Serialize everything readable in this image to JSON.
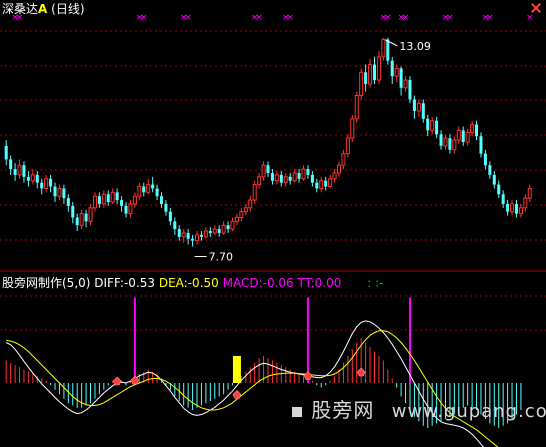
{
  "header": {
    "stock_name": "深桑达",
    "stock_suffix": "A",
    "period": "(日线)"
  },
  "price_annotations": {
    "high_label": "13.09",
    "low_label": "7.70"
  },
  "indicator": {
    "name": "股旁网制作(5,0)",
    "diff": "DIFF:-0.53",
    "dea": "DEA:-0.50",
    "macd": "MACD:-0.06",
    "tt": "TT:0.00",
    "dots": ": :-"
  },
  "watermark": {
    "site_cn": "股旁网",
    "site_url": "www.gupang.com"
  },
  "colors": {
    "background": "#000000",
    "up_candle": "#ff3232",
    "down_candle": "#54ffff",
    "grid": "#aa0000",
    "diff_line": "#ffffff",
    "dea_line": "#ffff00",
    "macd_pos": "#ff3232",
    "macd_neg": "#54ffff",
    "tt_bar": "#ff00ff",
    "signal_bar": "#ffff00"
  },
  "chart_data": {
    "type": "candlestick",
    "price_range": [
      7.3,
      13.5
    ],
    "candles": [
      [
        10.3,
        9.95,
        10.45,
        9.8
      ],
      [
        9.95,
        9.7,
        10.05,
        9.55
      ],
      [
        9.7,
        9.55,
        9.85,
        9.4
      ],
      [
        9.55,
        9.8,
        9.95,
        9.45
      ],
      [
        9.8,
        9.5,
        9.9,
        9.35
      ],
      [
        9.5,
        9.4,
        9.65,
        9.25
      ],
      [
        9.4,
        9.55,
        9.7,
        9.3
      ],
      [
        9.55,
        9.35,
        9.65,
        9.2
      ],
      [
        9.35,
        9.2,
        9.45,
        9.05
      ],
      [
        9.2,
        9.45,
        9.55,
        9.1
      ],
      [
        9.45,
        9.25,
        9.55,
        9.1
      ],
      [
        9.25,
        9.0,
        9.35,
        8.85
      ],
      [
        9.0,
        9.2,
        9.3,
        8.9
      ],
      [
        9.2,
        8.95,
        9.3,
        8.8
      ],
      [
        8.95,
        8.75,
        9.05,
        8.6
      ],
      [
        8.75,
        8.45,
        8.85,
        8.3
      ],
      [
        8.45,
        8.25,
        8.55,
        8.1
      ],
      [
        8.25,
        8.55,
        8.65,
        8.15
      ],
      [
        8.55,
        8.35,
        8.65,
        8.2
      ],
      [
        8.35,
        8.7,
        8.8,
        8.25
      ],
      [
        8.7,
        9.0,
        9.1,
        8.6
      ],
      [
        9.0,
        8.8,
        9.1,
        8.7
      ],
      [
        8.8,
        9.05,
        9.15,
        8.7
      ],
      [
        9.05,
        8.85,
        9.15,
        8.75
      ],
      [
        8.85,
        9.1,
        9.2,
        8.8
      ],
      [
        9.1,
        8.9,
        9.2,
        8.8
      ],
      [
        8.9,
        8.75,
        9.0,
        8.6
      ],
      [
        8.75,
        8.55,
        8.85,
        8.45
      ],
      [
        8.55,
        8.8,
        8.9,
        8.45
      ],
      [
        8.8,
        9.0,
        9.1,
        8.7
      ],
      [
        9.0,
        9.25,
        9.35,
        8.9
      ],
      [
        9.25,
        9.1,
        9.35,
        9.0
      ],
      [
        9.1,
        9.3,
        9.45,
        9.05
      ],
      [
        9.3,
        9.2,
        9.5,
        9.1
      ],
      [
        9.2,
        9.0,
        9.3,
        8.9
      ],
      [
        9.0,
        8.8,
        9.1,
        8.7
      ],
      [
        8.8,
        8.6,
        8.9,
        8.5
      ],
      [
        8.6,
        8.35,
        8.7,
        8.25
      ],
      [
        8.35,
        8.15,
        8.45,
        8.0
      ],
      [
        8.15,
        7.95,
        8.25,
        7.85
      ],
      [
        7.95,
        8.05,
        8.15,
        7.8
      ],
      [
        8.05,
        7.9,
        8.15,
        7.75
      ],
      [
        7.9,
        7.85,
        8.0,
        7.7
      ],
      [
        7.85,
        8.0,
        8.1,
        7.75
      ],
      [
        8.0,
        7.95,
        8.1,
        7.85
      ],
      [
        7.95,
        8.1,
        8.2,
        7.9
      ],
      [
        8.1,
        8.05,
        8.2,
        7.95
      ],
      [
        8.05,
        8.15,
        8.25,
        8.0
      ],
      [
        8.15,
        8.05,
        8.25,
        7.95
      ],
      [
        8.05,
        8.25,
        8.35,
        8.0
      ],
      [
        8.25,
        8.15,
        8.35,
        8.05
      ],
      [
        8.15,
        8.35,
        8.45,
        8.1
      ],
      [
        8.35,
        8.45,
        8.55,
        8.25
      ],
      [
        8.45,
        8.6,
        8.7,
        8.35
      ],
      [
        8.6,
        8.7,
        8.8,
        8.5
      ],
      [
        8.7,
        8.9,
        9.0,
        8.6
      ],
      [
        8.9,
        9.3,
        9.4,
        8.8
      ],
      [
        9.3,
        9.5,
        9.6,
        9.2
      ],
      [
        9.5,
        9.8,
        9.9,
        9.4
      ],
      [
        9.8,
        9.6,
        9.9,
        9.5
      ],
      [
        9.6,
        9.4,
        9.7,
        9.3
      ],
      [
        9.4,
        9.55,
        9.65,
        9.3
      ],
      [
        9.55,
        9.35,
        9.65,
        9.25
      ],
      [
        9.35,
        9.5,
        9.6,
        9.25
      ],
      [
        9.5,
        9.4,
        9.6,
        9.3
      ],
      [
        9.4,
        9.6,
        9.7,
        9.35
      ],
      [
        9.6,
        9.45,
        9.7,
        9.35
      ],
      [
        9.45,
        9.7,
        9.8,
        9.4
      ],
      [
        9.7,
        9.55,
        9.8,
        9.45
      ],
      [
        9.55,
        9.35,
        9.65,
        9.25
      ],
      [
        9.35,
        9.2,
        9.45,
        9.1
      ],
      [
        9.2,
        9.4,
        9.5,
        9.1
      ],
      [
        9.4,
        9.25,
        9.5,
        9.15
      ],
      [
        9.25,
        9.45,
        9.55,
        9.2
      ],
      [
        9.45,
        9.6,
        9.7,
        9.35
      ],
      [
        9.6,
        9.8,
        9.9,
        9.5
      ],
      [
        9.8,
        10.1,
        10.2,
        9.7
      ],
      [
        10.1,
        10.5,
        10.6,
        10.0
      ],
      [
        10.5,
        11.0,
        11.1,
        10.4
      ],
      [
        11.0,
        11.6,
        11.7,
        10.9
      ],
      [
        11.6,
        12.2,
        12.3,
        11.5
      ],
      [
        12.2,
        11.9,
        12.4,
        11.7
      ],
      [
        11.9,
        12.4,
        12.55,
        11.8
      ],
      [
        12.4,
        12.0,
        12.6,
        11.9
      ],
      [
        12.0,
        12.6,
        12.75,
        11.9
      ],
      [
        12.6,
        13.05,
        13.09,
        12.5
      ],
      [
        13.05,
        12.5,
        13.09,
        12.4
      ],
      [
        12.5,
        12.1,
        12.6,
        11.9
      ],
      [
        12.1,
        12.3,
        12.4,
        11.95
      ],
      [
        12.3,
        11.8,
        12.35,
        11.6
      ],
      [
        11.8,
        12.0,
        12.1,
        11.7
      ],
      [
        12.0,
        11.5,
        12.1,
        11.4
      ],
      [
        11.5,
        11.2,
        11.6,
        11.0
      ],
      [
        11.2,
        11.4,
        11.5,
        11.05
      ],
      [
        11.4,
        11.0,
        11.5,
        10.9
      ],
      [
        11.0,
        10.7,
        11.1,
        10.55
      ],
      [
        10.7,
        10.95,
        11.05,
        10.6
      ],
      [
        10.95,
        10.6,
        11.05,
        10.5
      ],
      [
        10.6,
        10.3,
        10.7,
        10.2
      ],
      [
        10.3,
        10.5,
        10.6,
        10.2
      ],
      [
        10.5,
        10.2,
        10.6,
        10.1
      ],
      [
        10.2,
        10.45,
        10.55,
        10.1
      ],
      [
        10.45,
        10.7,
        10.8,
        10.35
      ],
      [
        10.7,
        10.4,
        10.8,
        10.3
      ],
      [
        10.4,
        10.65,
        10.75,
        10.3
      ],
      [
        10.65,
        10.85,
        10.95,
        10.55
      ],
      [
        10.85,
        10.55,
        10.95,
        10.45
      ],
      [
        10.55,
        10.1,
        10.65,
        10.0
      ],
      [
        10.1,
        9.8,
        10.2,
        9.7
      ],
      [
        9.8,
        9.55,
        9.9,
        9.45
      ],
      [
        9.55,
        9.3,
        9.65,
        9.2
      ],
      [
        9.3,
        9.05,
        9.4,
        8.95
      ],
      [
        9.05,
        8.8,
        9.15,
        8.7
      ],
      [
        8.8,
        8.6,
        8.9,
        8.5
      ],
      [
        8.6,
        8.8,
        8.9,
        8.5
      ],
      [
        8.8,
        8.55,
        8.9,
        8.45
      ],
      [
        8.55,
        8.7,
        8.8,
        8.45
      ],
      [
        8.7,
        8.95,
        9.05,
        8.6
      ],
      [
        8.95,
        9.2,
        9.3,
        8.85
      ]
    ],
    "macd_hist": [
      0.5,
      0.45,
      0.4,
      0.35,
      0.3,
      0.25,
      0.2,
      0.15,
      0.1,
      0.05,
      -0.05,
      -0.15,
      -0.25,
      -0.35,
      -0.45,
      -0.5,
      -0.55,
      -0.55,
      -0.5,
      -0.45,
      -0.35,
      -0.25,
      -0.15,
      -0.05,
      0.05,
      0.1,
      0.05,
      -0.05,
      0.05,
      0.15,
      0.2,
      0.25,
      0.3,
      0.25,
      0.2,
      0.1,
      -0.05,
      -0.15,
      -0.3,
      -0.4,
      -0.5,
      -0.55,
      -0.6,
      -0.55,
      -0.5,
      -0.45,
      -0.4,
      -0.35,
      -0.3,
      -0.25,
      -0.15,
      -0.05,
      0.05,
      0.15,
      0.25,
      0.35,
      0.45,
      0.55,
      0.6,
      0.55,
      0.5,
      0.45,
      0.4,
      0.35,
      0.3,
      0.25,
      0.2,
      0.15,
      0.1,
      0.05,
      -0.05,
      -0.1,
      -0.05,
      0.05,
      0.15,
      0.3,
      0.45,
      0.6,
      0.75,
      0.9,
      1.0,
      0.9,
      0.8,
      0.7,
      0.6,
      0.5,
      0.3,
      0.1,
      -0.1,
      -0.3,
      -0.45,
      -0.6,
      -0.75,
      -0.85,
      -0.95,
      -1.0,
      -0.95,
      -0.9,
      -0.85,
      -0.8,
      -0.75,
      -0.7,
      -0.6,
      -0.55,
      -0.5,
      -0.55,
      -0.6,
      -0.7,
      -0.8,
      -0.9,
      -0.95,
      -1.0,
      -0.95,
      -0.9,
      -0.8,
      -0.7,
      -0.6
    ],
    "diff_line": [
      0.9,
      0.85,
      0.75,
      0.62,
      0.48,
      0.35,
      0.22,
      0.1,
      -0.02,
      -0.12,
      -0.22,
      -0.32,
      -0.42,
      -0.5,
      -0.58,
      -0.64,
      -0.68,
      -0.66,
      -0.6,
      -0.52,
      -0.42,
      -0.32,
      -0.22,
      -0.14,
      -0.06,
      0.0,
      0.02,
      0.0,
      0.04,
      0.1,
      0.16,
      0.2,
      0.24,
      0.22,
      0.16,
      0.06,
      -0.06,
      -0.18,
      -0.32,
      -0.44,
      -0.56,
      -0.64,
      -0.7,
      -0.72,
      -0.7,
      -0.66,
      -0.6,
      -0.54,
      -0.46,
      -0.38,
      -0.28,
      -0.18,
      -0.06,
      0.06,
      0.16,
      0.26,
      0.34,
      0.4,
      0.44,
      0.42,
      0.38,
      0.34,
      0.3,
      0.27,
      0.24,
      0.22,
      0.2,
      0.18,
      0.16,
      0.14,
      0.12,
      0.12,
      0.16,
      0.24,
      0.36,
      0.52,
      0.7,
      0.9,
      1.1,
      1.25,
      1.35,
      1.38,
      1.36,
      1.3,
      1.22,
      1.12,
      1.0,
      0.86,
      0.7,
      0.54,
      0.36,
      0.18,
      0.0,
      -0.18,
      -0.36,
      -0.52,
      -0.66,
      -0.78,
      -0.86,
      -0.9,
      -0.92,
      -0.94,
      -0.96,
      -1.0,
      -1.06,
      -1.14,
      -1.24,
      -1.36,
      -1.48,
      -1.58,
      -1.66,
      -1.72,
      -1.76,
      -1.76,
      -1.72,
      -1.66,
      -1.58
    ],
    "dea_line": [
      0.95,
      0.93,
      0.9,
      0.85,
      0.78,
      0.7,
      0.6,
      0.5,
      0.4,
      0.3,
      0.2,
      0.1,
      0.0,
      -0.1,
      -0.2,
      -0.3,
      -0.38,
      -0.44,
      -0.48,
      -0.5,
      -0.5,
      -0.48,
      -0.44,
      -0.38,
      -0.32,
      -0.26,
      -0.2,
      -0.14,
      -0.08,
      -0.04,
      0.0,
      0.04,
      0.08,
      0.1,
      0.1,
      0.08,
      0.04,
      -0.02,
      -0.1,
      -0.18,
      -0.28,
      -0.36,
      -0.44,
      -0.5,
      -0.55,
      -0.58,
      -0.6,
      -0.6,
      -0.58,
      -0.55,
      -0.5,
      -0.44,
      -0.36,
      -0.28,
      -0.2,
      -0.12,
      -0.04,
      0.04,
      0.1,
      0.15,
      0.18,
      0.2,
      0.21,
      0.22,
      0.22,
      0.22,
      0.21,
      0.2,
      0.19,
      0.18,
      0.17,
      0.16,
      0.16,
      0.17,
      0.2,
      0.26,
      0.34,
      0.44,
      0.56,
      0.7,
      0.84,
      0.96,
      1.06,
      1.12,
      1.16,
      1.16,
      1.14,
      1.08,
      1.0,
      0.9,
      0.78,
      0.64,
      0.5,
      0.34,
      0.18,
      0.02,
      -0.14,
      -0.3,
      -0.44,
      -0.56,
      -0.66,
      -0.74,
      -0.8,
      -0.86,
      -0.92,
      -0.98,
      -1.04,
      -1.12,
      -1.2,
      -1.28,
      -1.36,
      -1.44,
      -1.5,
      -1.56,
      -1.6,
      -1.62,
      -1.62
    ],
    "tt_spikes": [
      [
        29,
        1.9
      ],
      [
        68,
        1.9
      ],
      [
        91,
        1.9
      ]
    ],
    "cross_markers": [
      [
        25,
        0.0
      ],
      [
        29,
        0.02
      ],
      [
        68,
        0.12
      ],
      [
        80,
        0.2
      ],
      [
        52,
        -0.3
      ]
    ],
    "signal_bar": [
      [
        52,
        0.6
      ]
    ],
    "top_markers": [
      2,
      3,
      30,
      31,
      40,
      41,
      56,
      57,
      63,
      64,
      85,
      86,
      89,
      90,
      99,
      100,
      108,
      109,
      118
    ]
  }
}
